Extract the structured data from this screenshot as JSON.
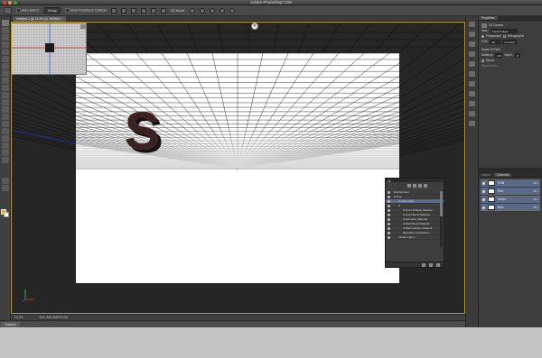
{
  "app": {
    "title": "Adobe Photoshop CS6",
    "traffic_lights": [
      "#e0443e",
      "#dea123",
      "#27aa35"
    ]
  },
  "options_bar": {
    "tool_icon": "move-tool-icon",
    "auto_select_label": "Auto-Select:",
    "auto_select_value": "Group",
    "show_transform_label": "Show Transform Controls",
    "mode_label": "3D Mode:"
  },
  "document": {
    "tab_title": "Untitled-1 @ 13.2% (S, RGB/8) *",
    "zoom": "13.2%",
    "doc_size": "Doc: 330.0M/970.0M",
    "extruded_letter": "S",
    "floor_grid_lines": 30,
    "camera_widget_icon": "camera-orbit-icon"
  },
  "status_bar": {
    "zoom": "13.2%",
    "doc_info": "Doc: 330.0M/970.0M"
  },
  "timeline": {
    "label": "Timeline"
  },
  "properties_panel": {
    "tab": "Properties",
    "section_title": "3D Camera",
    "view_label": "View:",
    "view_value": "Current View",
    "perspective_label": "Perspective",
    "orthographic_label": "Orthographic",
    "fov_label": "FOV:",
    "fov_value": "40",
    "fov_unit": "mm lens",
    "dof_title": "Depth Of Field",
    "distance_label": "Distance:",
    "distance_value": "0.5",
    "depth_label": "Depth:",
    "depth_value": "0",
    "stereo_label": "Stereo",
    "stereo_view_label": "Stereo View:"
  },
  "channels_panel": {
    "tabs": [
      "Layers",
      "Channels"
    ],
    "active_tab": "Channels",
    "channels": [
      {
        "name": "RGB",
        "shortcut": "⌘2"
      },
      {
        "name": "Red",
        "shortcut": "⌘3"
      },
      {
        "name": "Green",
        "shortcut": "⌘4"
      },
      {
        "name": "Blue",
        "shortcut": "⌘5"
      }
    ]
  },
  "scene_panel": {
    "title": "3D",
    "items": [
      {
        "label": "Environment",
        "indent": 0
      },
      {
        "label": "Scene",
        "indent": 0
      },
      {
        "label": "Current View",
        "indent": 1,
        "selected": true
      },
      {
        "label": "S",
        "indent": 1
      },
      {
        "label": "S Front Inflation Material",
        "indent": 2
      },
      {
        "label": "S Front Bevel Material",
        "indent": 2
      },
      {
        "label": "S Extrusion Material",
        "indent": 2
      },
      {
        "label": "S Back Bevel Material",
        "indent": 2
      },
      {
        "label": "S Back Inflation Material",
        "indent": 2
      },
      {
        "label": "Boundary Constraint 1",
        "indent": 2
      },
      {
        "label": "Infinite Light 1",
        "indent": 1
      }
    ]
  },
  "colors": {
    "foreground": "#e8a838",
    "background": "#ffffff",
    "selection": "#5d6c86",
    "active_doc_border": "#b99b26"
  }
}
